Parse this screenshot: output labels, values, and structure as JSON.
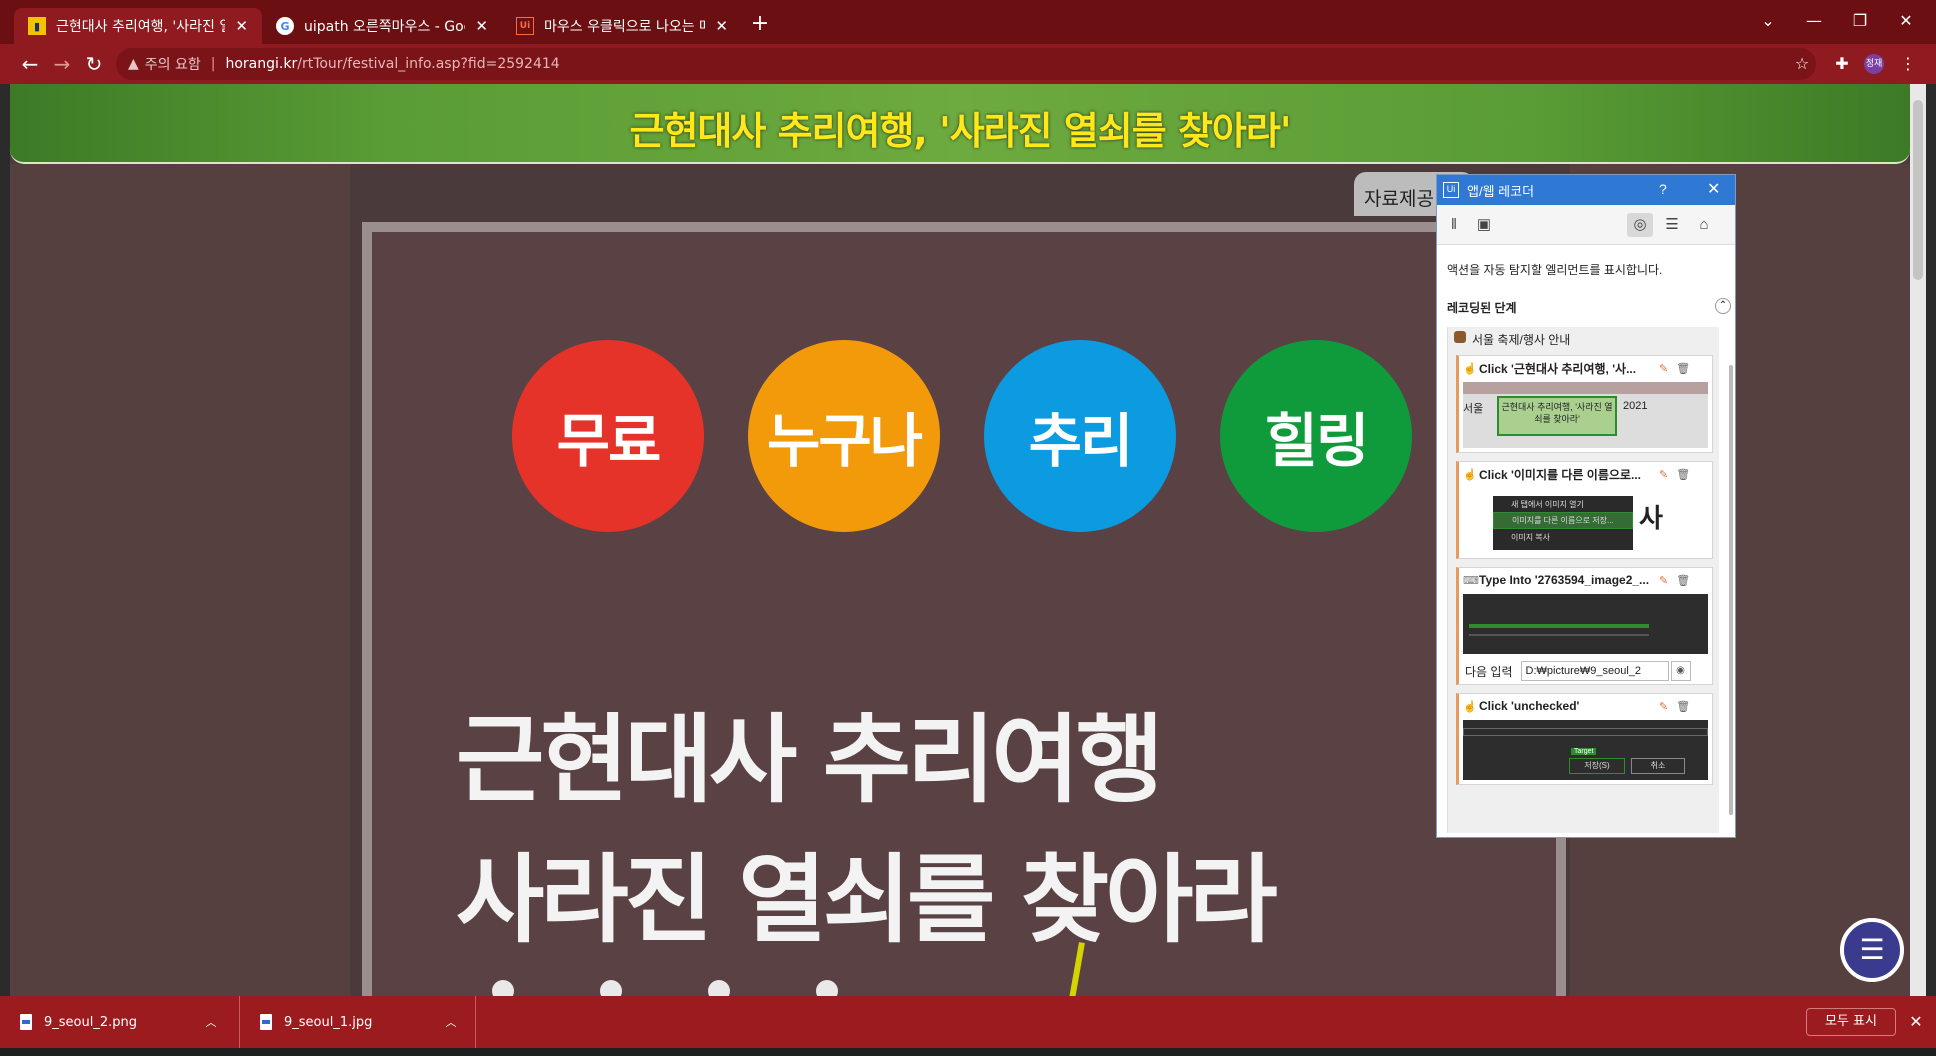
{
  "browser": {
    "tabs": [
      {
        "title": "근현대사 추리여행, '사라진 열쇠를 찾아라'",
        "favicon": "T"
      },
      {
        "title": "uipath 오른쪽마우스 - Google 검색",
        "favicon": "G"
      },
      {
        "title": "마우스 우클릭으로 나오는 메뉴에서",
        "favicon": "Ui"
      }
    ],
    "new_tab": "+",
    "window_controls": {
      "dropdown": "⌄",
      "minimize": "—",
      "restore": "❐",
      "close": "✕"
    },
    "address": {
      "security": "주의 요함",
      "host": "horangi.kr",
      "path": "/rtTour/festival_info.asp?fid=2592414"
    },
    "profile": "정재",
    "accent": "#8f1a1f"
  },
  "page": {
    "banner_title": "근현대사 추리여행, '사라진 열쇠를 찾아라'",
    "source_tab": "자료제공:",
    "circles": [
      {
        "label": "무료",
        "color": "#e63329"
      },
      {
        "label": "누구나",
        "color": "#f39a0a"
      },
      {
        "label": "추리",
        "color": "#0c9be0"
      },
      {
        "label": "힐링",
        "color": "#0f9a3c"
      }
    ],
    "poster_title_1": "근현대사 추리여행",
    "poster_title_2": "사라진 열쇠를 찾아라"
  },
  "recorder": {
    "title": "앱/웹 레코더",
    "help": "?",
    "close": "✕",
    "info": "액션을 자동 탐지할 엘리먼트를 표시합니다.",
    "section": "레코딩된 단계",
    "parent": "서울 축제/행사 안내",
    "steps": [
      {
        "label": "Click '근현대사 추리여행, '사...",
        "thumb_text_1": "근현대사 추리여행, '사라진 열쇠를 찾아라'",
        "thumb_left": "서울",
        "thumb_right": "2021"
      },
      {
        "label": "Click '이미지를 다른 이름으로...",
        "menu_1": "새 탭에서 이미지 열기",
        "menu_2": "이미지를 다른 이름으로 저장...",
        "menu_3": "이미지 복사"
      },
      {
        "label": "Type Into '2763594_image2_...",
        "input_label": "다음 입력",
        "input_value": "D:₩picture₩9_seoul_2"
      },
      {
        "label": "Click 'unchecked'",
        "target": "Target",
        "save": "저장(S)",
        "cancel": "취소"
      }
    ]
  },
  "downloads": {
    "items": [
      {
        "name": "9_seoul_2.png"
      },
      {
        "name": "9_seoul_1.jpg"
      }
    ],
    "show_all": "모두 표시"
  }
}
